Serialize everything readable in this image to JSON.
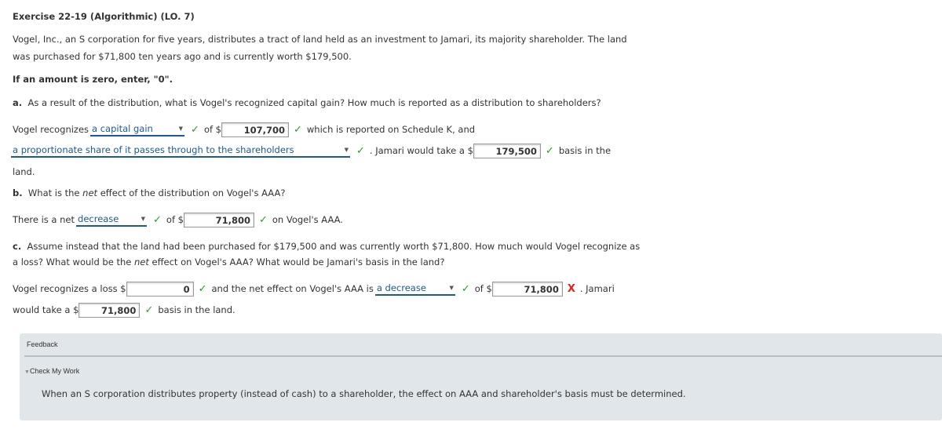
{
  "title": "Exercise 22-19 (Algorithmic) (LO. 7)",
  "intro": [
    "Vogel, Inc., an S corporation for five years, distributes a tract of land held as an investment to Jamari, its majority shareholder. The land",
    "was purchased for $71,800 ten years ago and is currently worth $179,500."
  ],
  "zero_note": "If an amount is zero, enter, \"0\".",
  "part_a": {
    "letter": "a.",
    "question": "As a result of the distribution, what is Vogel's recognized capital gain? How much is reported as a distribution to shareholders?",
    "t1": "Vogel recognizes",
    "select1": "a capital gain",
    "t2": "of $",
    "input1": "107,700",
    "t3": "which is reported on Schedule K, and",
    "select2": "a proportionate share of it passes through to the shareholders",
    "t4": ". Jamari would take a $",
    "input2": "179,500",
    "t5": "basis in the",
    "t6": "land."
  },
  "part_b": {
    "letter": "b.",
    "q1": "What is the",
    "q_em": "net",
    "q2": "effect of the distribution on Vogel's AAA?",
    "t1": "There is a net",
    "select1": "decrease",
    "t2": "of $",
    "input1": "71,800",
    "t3": "on Vogel's AAA."
  },
  "part_c": {
    "letter": "c.",
    "q_line1": "Assume instead that the land had been purchased for $179,500 and was currently worth $71,800. How much would Vogel recognize as",
    "q_line2a": "a loss? What would be the",
    "q_em": "net",
    "q_line2b": "effect on Vogel's AAA? What would be Jamari's basis in the land?",
    "t1": "Vogel recognizes a loss $",
    "input1": "0",
    "t2": "and the net effect on Vogel's AAA is",
    "select1": "a decrease",
    "t3": "of $",
    "input2": "71,800",
    "t4": ". Jamari",
    "t5": "would take a $",
    "input3": "71,800",
    "t6": "basis in the land."
  },
  "feedback": {
    "label": "Feedback",
    "check_my_work": "Check My Work",
    "text": "When an S corporation distributes property (instead of cash) to a shareholder, the effect on AAA and shareholder's basis must be determined."
  },
  "marks": {
    "correct": "✓",
    "incorrect": "X"
  },
  "colors": {
    "link": "#1a5a96",
    "correct": "#2a9a2a",
    "incorrect": "#e02020",
    "panel": "#e1e6ea"
  }
}
